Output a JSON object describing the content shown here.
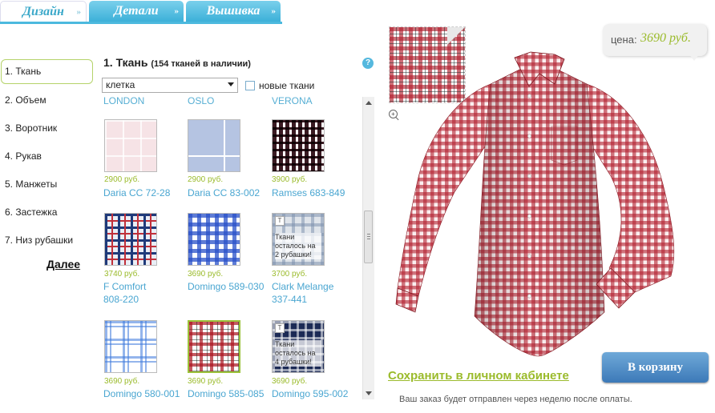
{
  "tabs": [
    {
      "label": "Дизайн"
    },
    {
      "label": "Детали"
    },
    {
      "label": "Вышивка"
    }
  ],
  "steps": [
    {
      "label": "1. Ткань",
      "active": true
    },
    {
      "label": "2. Объем"
    },
    {
      "label": "3. Воротник"
    },
    {
      "label": "4. Рукав"
    },
    {
      "label": "5. Манжеты"
    },
    {
      "label": "6. Застежка"
    },
    {
      "label": "7. Низ рубашки"
    }
  ],
  "next_label": "Далее",
  "fabric_panel": {
    "title": "1. Ткань",
    "count": "(154 тканей в наличии)",
    "help": "?",
    "filter_value": "клетка",
    "new_fabrics_label": "новые ткани",
    "categories": [
      "LONDON",
      "OSLO",
      "VERONA"
    ],
    "stock_note": "Ткани осталось на 2 рубашки!",
    "stock_note_2": "Ткани осталось на 4 рубашки!",
    "fabrics": [
      {
        "price": "2900 руб.",
        "name": "Daria CC 72-28"
      },
      {
        "price": "2900 руб.",
        "name": "Daria CC 83-002"
      },
      {
        "price": "3900 руб.",
        "name": "Ramses 683-849"
      },
      {
        "price": "3740 руб.",
        "name": "F Comfort 808-220"
      },
      {
        "price": "3690 руб.",
        "name": "Domingo 589-030"
      },
      {
        "price": "3700 руб.",
        "name": "Clark Melange 337-441"
      },
      {
        "price": "3690 руб.",
        "name": "Domingo 580-001"
      },
      {
        "price": "3690 руб.",
        "name": "Domingo 585-085"
      },
      {
        "price": "3690 руб.",
        "name": "Domingo 595-002"
      }
    ]
  },
  "preview": {
    "price_label": "цена:",
    "price_value": "3690 руб.",
    "save_label": "Сохранить в личном кабинете",
    "cart_label": "В корзину",
    "shipping_note": "Ваш заказ будет отправлен через неделю после оплаты."
  },
  "colors": {
    "accent_blue": "#4cb9de",
    "accent_green": "#9bbb2c",
    "shirt_red": "#b3202e",
    "link_blue": "#4aa6d1"
  }
}
